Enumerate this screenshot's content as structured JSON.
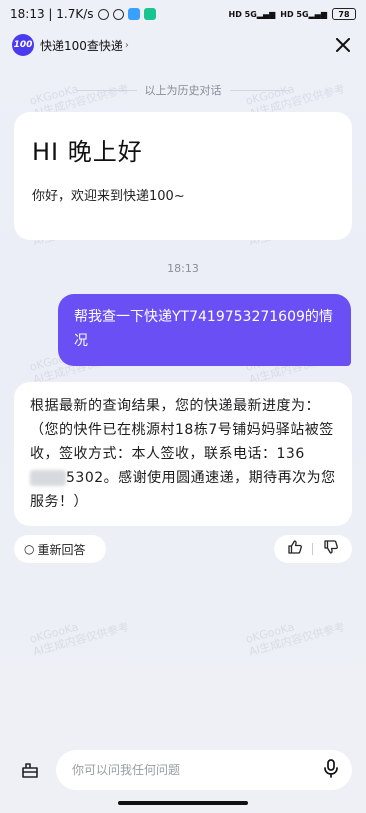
{
  "status_bar": {
    "time_speed": "18:13 | 1.7K/s",
    "signal_1": "5G",
    "signal_2": "5G",
    "battery": "78"
  },
  "header": {
    "logo_text": "100",
    "title": "快递100查快递",
    "chevron": "›"
  },
  "history": {
    "label": "以上为历史对话"
  },
  "welcome": {
    "title": "HI 晚上好",
    "subtitle": "你好，欢迎来到快递100~"
  },
  "chat": {
    "timestamp": "18:13",
    "user_message": "帮我查一下快递YT7419753271609的情况",
    "reply_part1": "根据最新的查询结果，您的快递最新进度为：（您的快件已在桃源村18栋7号铺妈妈驿站被签收，签收方式：本人签收，联系电话：136",
    "reply_part2": "5302。感谢使用圆通速递，期待再次为您服务！）"
  },
  "actions": {
    "regenerate": "重新回答",
    "regenerate_glyph": "○"
  },
  "watermark": {
    "line1": "oKGooKa",
    "line2": "AI生成内容仅供参考"
  },
  "input": {
    "placeholder": "你可以问我任何问题"
  },
  "colors": {
    "accent": "#6a4ff5",
    "logo": "#4b3bf0",
    "background": "#eef0f8"
  }
}
